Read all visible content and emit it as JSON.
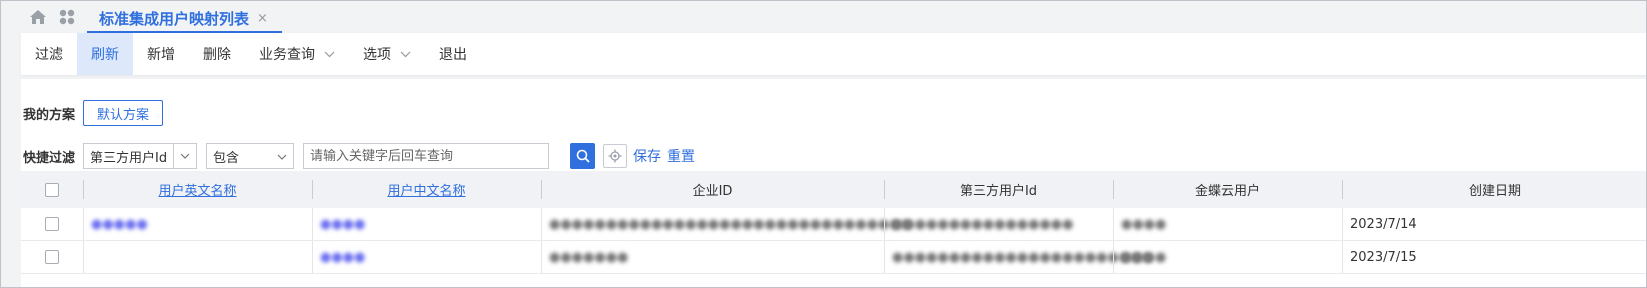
{
  "tab": {
    "title": "标准集成用户映射列表",
    "close": "×"
  },
  "toolbar": [
    {
      "label": "过滤",
      "active": false,
      "dropdown": false
    },
    {
      "label": "刷新",
      "active": true,
      "dropdown": false
    },
    {
      "label": "新增",
      "active": false,
      "dropdown": false
    },
    {
      "label": "删除",
      "active": false,
      "dropdown": false
    },
    {
      "label": "业务查询",
      "active": false,
      "dropdown": true
    },
    {
      "label": "选项",
      "active": false,
      "dropdown": true
    },
    {
      "label": "退出",
      "active": false,
      "dropdown": false
    }
  ],
  "scheme": {
    "label": "我的方案",
    "default_button": "默认方案"
  },
  "filter": {
    "label": "快捷过滤",
    "field": "第三方用户Id",
    "operator": "包含",
    "placeholder": "请输入关键字后回车查询",
    "save": "保存",
    "reset": "重置"
  },
  "table": {
    "columns": [
      "",
      "用户英文名称",
      "用户中文名称",
      "企业ID",
      "第三方用户Id",
      "金蝶云用户",
      "创建日期"
    ],
    "rows": [
      {
        "en_name": "●●●●●",
        "cn_name": "●●●●",
        "corp_id": "●●●●●●●●●●●●●●●●●●●●●●●●●●●●●●●●",
        "third_id": "●●●●●●●●●●●●●●●●",
        "kd_user": "●●●●",
        "created": "2023/7/14"
      },
      {
        "en_name": "",
        "cn_name": "●●●●",
        "corp_id": "●●●●●●●",
        "third_id": "●●●●●●●●●●●●●●●●●●●●●●●",
        "kd_user": "●●●●",
        "created": "2023/7/15"
      }
    ]
  },
  "colors": {
    "accent": "#2f6fde",
    "active_bg": "#dde8fb"
  },
  "icons": [
    "home-icon",
    "apps-icon",
    "close-icon",
    "chevron-down-icon",
    "search-icon",
    "settings-icon"
  ]
}
